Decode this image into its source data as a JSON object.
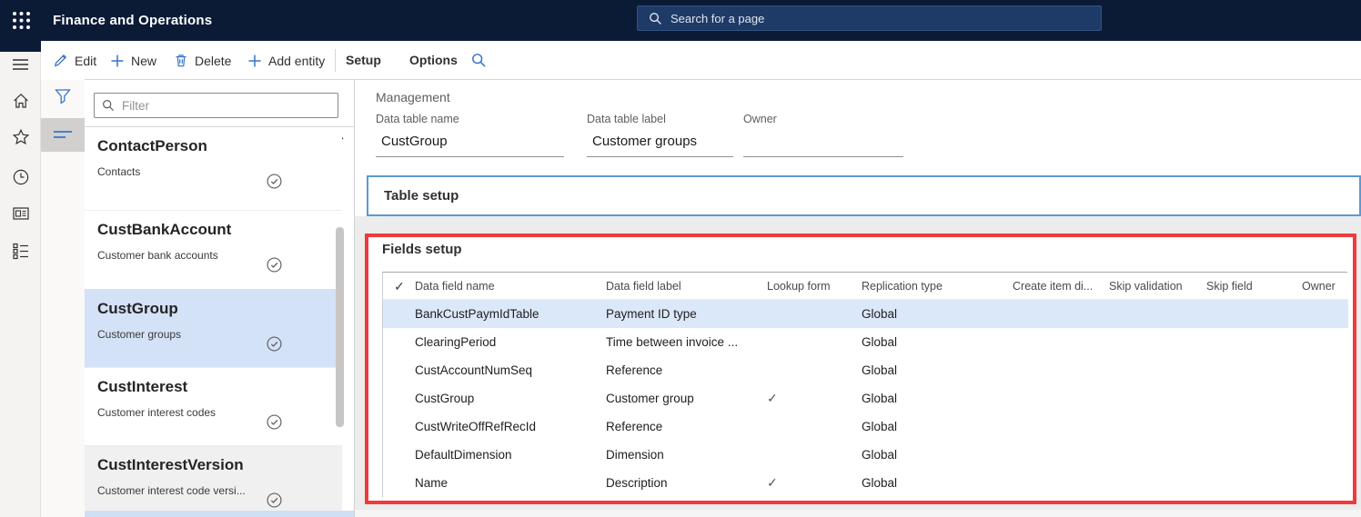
{
  "colors": {
    "topbar_bg": "#0b1b36",
    "search_bg": "#1e3a66",
    "accent_blue": "#3674c9",
    "selected_item_bg": "#d3e2f7",
    "row_highlight_bg": "#dbe8f9",
    "annotation_red": "#ef3a3e",
    "section_border_blue": "#5a9ad3"
  },
  "topbar": {
    "app_title": "Finance and Operations",
    "search_placeholder": "Search for a page"
  },
  "toolbar": {
    "buttons": [
      {
        "label": "Edit",
        "icon": "pencil-icon"
      },
      {
        "label": "New",
        "icon": "plus-icon"
      },
      {
        "label": "Delete",
        "icon": "trash-icon"
      },
      {
        "label": "Add entity",
        "icon": "plus-icon"
      }
    ],
    "tabs": [
      {
        "label": "Setup"
      },
      {
        "label": "Options"
      }
    ],
    "icons": [
      "search-icon"
    ]
  },
  "left_rail_icons": [
    "hamburger-icon",
    "home-icon",
    "star-icon",
    "clock-icon",
    "recent-pages-icon",
    "hierarchy-list-icon"
  ],
  "sub_rail_icons": [
    "filter-funnel-icon",
    "list-lines-icon"
  ],
  "entity_list": {
    "filter_placeholder": "Filter",
    "items": [
      {
        "name": "ContactPerson",
        "description": "Contacts",
        "selected": false,
        "dimmed": false
      },
      {
        "name": "CustBankAccount",
        "description": "Customer bank accounts",
        "selected": false,
        "dimmed": false
      },
      {
        "name": "CustGroup",
        "description": "Customer groups",
        "selected": true,
        "dimmed": false
      },
      {
        "name": "CustInterest",
        "description": "Customer interest codes",
        "selected": false,
        "dimmed": false
      },
      {
        "name": "CustInterestVersion",
        "description": "Customer interest code versi...",
        "selected": false,
        "dimmed": true
      }
    ]
  },
  "detail": {
    "section_label": "Management",
    "fields": [
      {
        "label": "Data table name",
        "value": "CustGroup"
      },
      {
        "label": "Data table label",
        "value": "Customer groups"
      },
      {
        "label": "Owner",
        "value": ""
      }
    ],
    "table_setup_title": "Table setup",
    "fields_setup_title": "Fields setup",
    "grid": {
      "header_check_mark": "✓",
      "columns": [
        "Data field name",
        "Data field label",
        "Lookup form",
        "Replication type",
        "Create item di...",
        "Skip validation",
        "Skip field",
        "Owner"
      ],
      "rows": [
        {
          "name": "BankCustPaymIdTable",
          "label": "Payment ID type",
          "lookup_form": "",
          "replication_type": "Global",
          "highlighted": true
        },
        {
          "name": "ClearingPeriod",
          "label": "Time between invoice ...",
          "lookup_form": "",
          "replication_type": "Global",
          "highlighted": false
        },
        {
          "name": "CustAccountNumSeq",
          "label": "Reference",
          "lookup_form": "",
          "replication_type": "Global",
          "highlighted": false
        },
        {
          "name": "CustGroup",
          "label": "Customer group",
          "lookup_form": "✓",
          "replication_type": "Global",
          "highlighted": false
        },
        {
          "name": "CustWriteOffRefRecId",
          "label": "Reference",
          "lookup_form": "",
          "replication_type": "Global",
          "highlighted": false
        },
        {
          "name": "DefaultDimension",
          "label": "Dimension",
          "lookup_form": "",
          "replication_type": "Global",
          "highlighted": false
        },
        {
          "name": "Name",
          "label": "Description",
          "lookup_form": "✓",
          "replication_type": "Global",
          "highlighted": false
        }
      ]
    }
  }
}
